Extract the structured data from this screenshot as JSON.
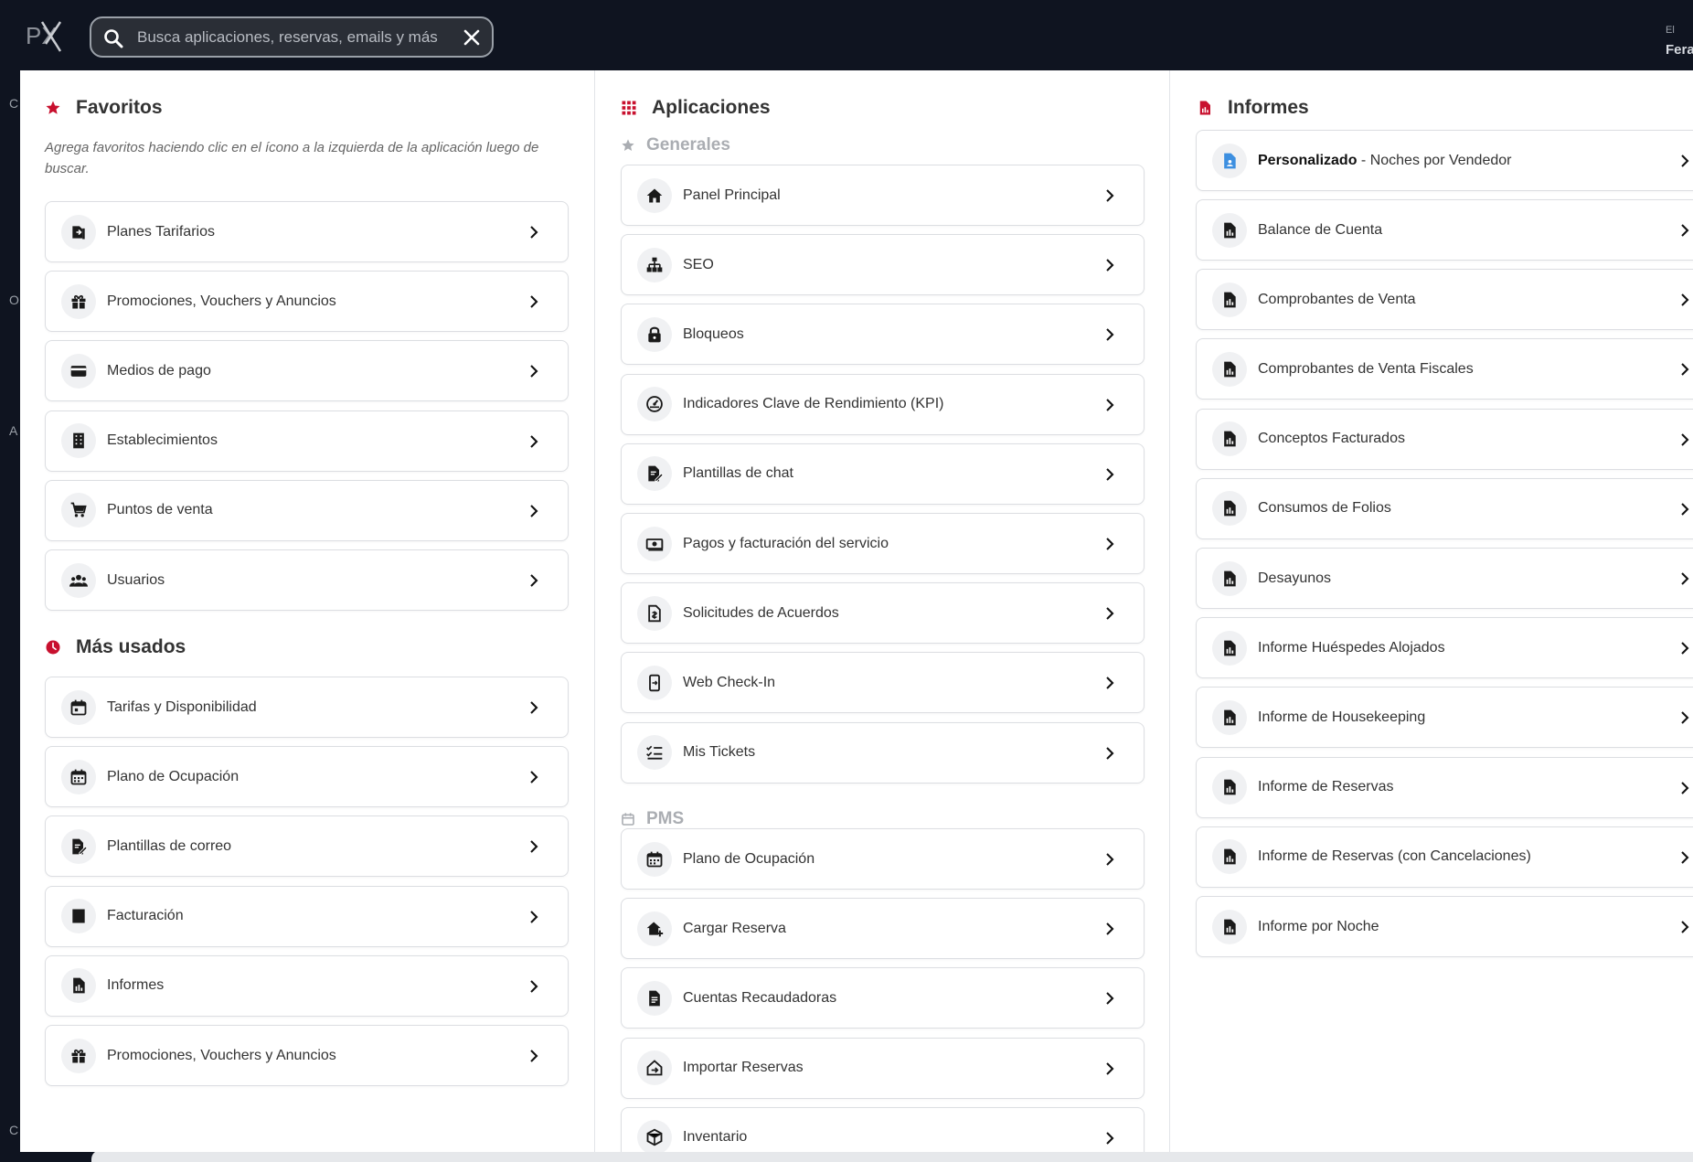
{
  "topbar": {
    "logo_text": "PX",
    "search_placeholder": "Busca aplicaciones, reservas, emails y más",
    "right_small": "El",
    "right_name": "Fera"
  },
  "left_edge": [
    "C",
    "O",
    "A",
    "C"
  ],
  "favoritos": {
    "title": "Favoritos",
    "hint": "Agrega favoritos haciendo clic en el ícono a la izquierda de la aplicación luego de buscar.",
    "items": [
      {
        "label": "Planes Tarifarios",
        "icon": "tariff-plans-icon"
      },
      {
        "label": "Promociones, Vouchers y Anuncios",
        "icon": "gift-icon"
      },
      {
        "label": "Medios de pago",
        "icon": "credit-card-icon"
      },
      {
        "label": "Establecimientos",
        "icon": "building-icon"
      },
      {
        "label": "Puntos de venta",
        "icon": "cart-icon"
      },
      {
        "label": "Usuarios",
        "icon": "users-icon"
      }
    ]
  },
  "mas_usados": {
    "title": "Más usados",
    "items": [
      {
        "label": "Tarifas y Disponibilidad",
        "icon": "calendar-icon"
      },
      {
        "label": "Plano de Ocupación",
        "icon": "calendar-grid-icon"
      },
      {
        "label": "Plantillas de correo",
        "icon": "template-edit-icon"
      },
      {
        "label": "Facturación",
        "icon": "invoice-icon"
      },
      {
        "label": "Informes",
        "icon": "report-icon"
      },
      {
        "label": "Promociones, Vouchers y Anuncios",
        "icon": "gift-icon"
      }
    ]
  },
  "aplicaciones": {
    "title": "Aplicaciones",
    "generales_title": "Generales",
    "generales": [
      {
        "label": "Panel Principal",
        "icon": "home-icon"
      },
      {
        "label": "SEO",
        "icon": "sitemap-icon"
      },
      {
        "label": "Bloqueos",
        "icon": "lock-icon"
      },
      {
        "label": "Indicadores Clave de Rendimiento (KPI)",
        "icon": "gauge-icon"
      },
      {
        "label": "Plantillas de chat",
        "icon": "template-edit-icon"
      },
      {
        "label": "Pagos y facturación del servicio",
        "icon": "money-icon"
      },
      {
        "label": "Solicitudes de Acuerdos",
        "icon": "contract-icon"
      },
      {
        "label": "Web Check-In",
        "icon": "mobile-checkin-icon"
      },
      {
        "label": "Mis Tickets",
        "icon": "checklist-icon"
      }
    ],
    "pms_title": "PMS",
    "pms": [
      {
        "label": "Plano de Ocupación",
        "icon": "calendar-grid-icon"
      },
      {
        "label": "Cargar Reserva",
        "icon": "home-add-icon"
      },
      {
        "label": "Cuentas Recaudadoras",
        "icon": "receipt-icon"
      },
      {
        "label": "Importar Reservas",
        "icon": "import-icon"
      },
      {
        "label": "Inventario",
        "icon": "box-icon"
      }
    ]
  },
  "informes": {
    "title": "Informes",
    "custom_bold": "Personalizado",
    "custom_rest": " - Noches por Vendedor",
    "items": [
      {
        "label": "Balance de Cuenta",
        "icon": "report-icon"
      },
      {
        "label": "Comprobantes de Venta",
        "icon": "report-icon"
      },
      {
        "label": "Comprobantes de Venta Fiscales",
        "icon": "report-icon"
      },
      {
        "label": "Conceptos Facturados",
        "icon": "report-icon"
      },
      {
        "label": "Consumos de Folios",
        "icon": "report-icon"
      },
      {
        "label": "Desayunos",
        "icon": "report-icon"
      },
      {
        "label": "Informe Huéspedes Alojados",
        "icon": "report-icon"
      },
      {
        "label": "Informe de Housekeeping",
        "icon": "report-icon"
      },
      {
        "label": "Informe de Reservas",
        "icon": "report-icon"
      },
      {
        "label": "Informe de Reservas (con Cancelaciones)",
        "icon": "report-icon"
      },
      {
        "label": "Informe por Noche",
        "icon": "report-icon"
      }
    ]
  },
  "colors": {
    "accent_red": "#c8102e",
    "custom_report_blue": "#3d8fe0",
    "background_dark": "#0f1420"
  }
}
